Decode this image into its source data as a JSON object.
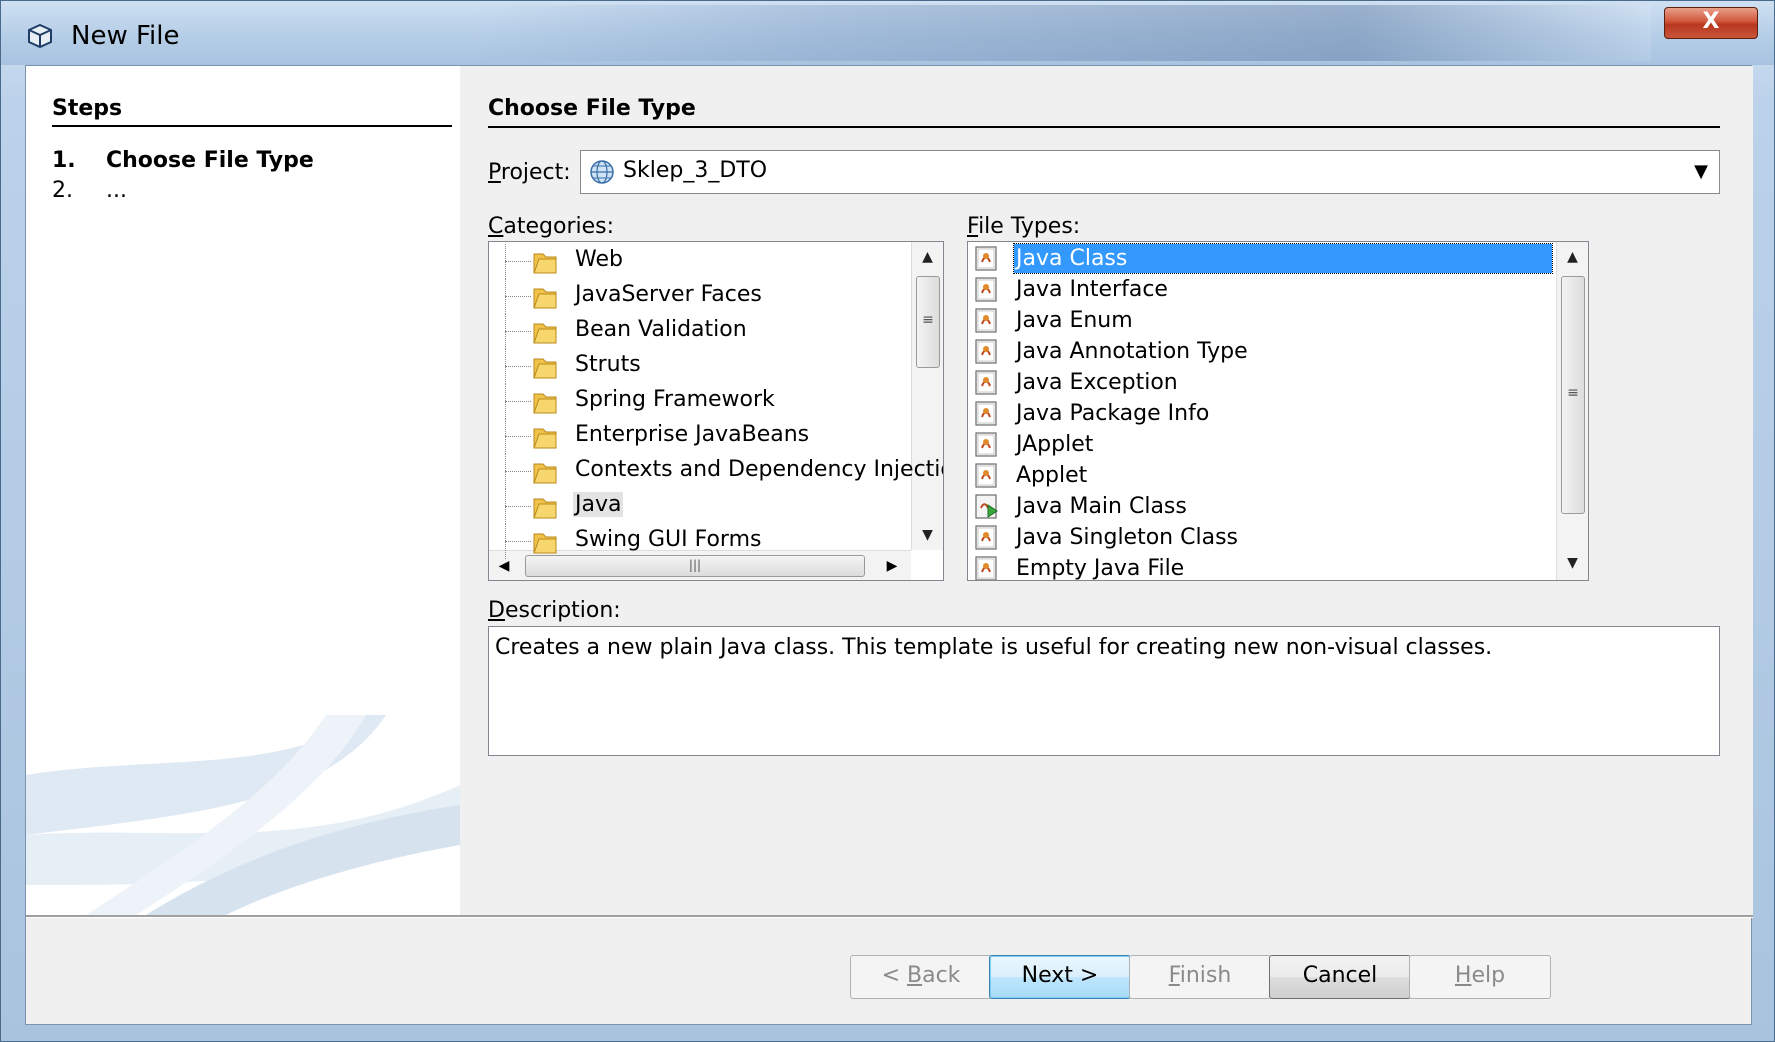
{
  "window": {
    "title": "New File",
    "close_label": "X"
  },
  "steps": {
    "heading": "Steps",
    "items": [
      {
        "num": "1.",
        "label": "Choose File Type"
      },
      {
        "num": "2.",
        "label": "..."
      }
    ]
  },
  "main": {
    "heading": "Choose File Type",
    "project": {
      "label": "Project:",
      "value": "Sklep_3_DTO"
    },
    "categories": {
      "label": "Categories:",
      "items": [
        "Web",
        "JavaServer Faces",
        "Bean Validation",
        "Struts",
        "Spring Framework",
        "Enterprise JavaBeans",
        "Contexts and Dependency Injection",
        "Java",
        "Swing GUI Forms"
      ],
      "selected": "Java"
    },
    "file_types": {
      "label": "File Types:",
      "items": [
        "Java Class",
        "Java Interface",
        "Java Enum",
        "Java Annotation Type",
        "Java Exception",
        "Java Package Info",
        "JApplet",
        "Applet",
        "Java Main Class",
        "Java Singleton Class",
        "Empty Java File"
      ],
      "selected": "Java Class"
    },
    "description": {
      "label": "Description:",
      "text": "Creates a new plain Java class. This template is useful for creating new non-visual classes."
    }
  },
  "buttons": {
    "back": "< Back",
    "next": "Next >",
    "finish": "Finish",
    "cancel": "Cancel",
    "help": "Help"
  },
  "icons": {
    "app": "cube-icon",
    "project": "globe-icon",
    "category": "folder-icon",
    "file_type": "java-file-icon",
    "main_class": "java-main-class-icon"
  },
  "colors": {
    "selection": "#3399ff",
    "close_button": "#c9553a",
    "default_button": "#3c7fb1"
  }
}
